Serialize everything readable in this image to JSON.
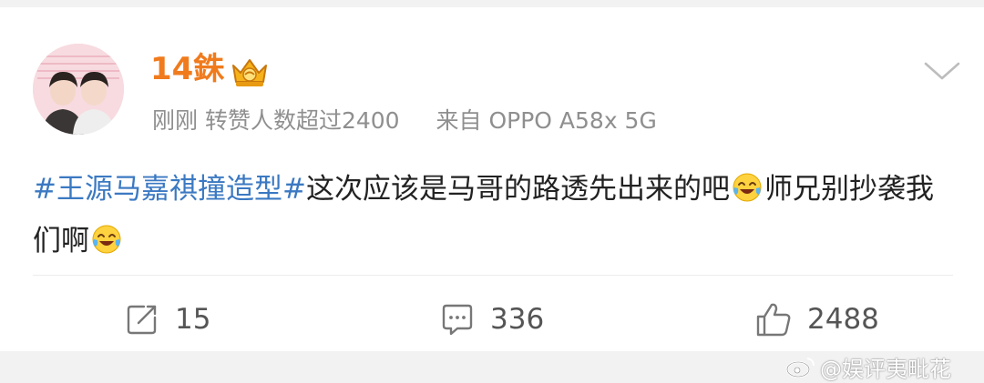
{
  "user": {
    "name": "14銖",
    "badge_icon": "crown-badge-icon"
  },
  "meta": {
    "time": "刚刚",
    "repost_note": "转赞人数超过2400",
    "source": "来自 OPPO A58x 5G"
  },
  "post": {
    "hashtag": "#王源马嘉祺撞造型#",
    "text_part1": "这次应该是马哥的路透先出来的吧",
    "emoji1": "laughing-tears-emoji",
    "text_part2": "师兄别抄袭我们啊",
    "emoji2": "laughing-tears-emoji"
  },
  "actions": {
    "repost_count": "15",
    "comment_count": "336",
    "like_count": "2488"
  },
  "watermark": {
    "text": "@娱评夷毗花",
    "icon": "weibo-logo-icon"
  },
  "colors": {
    "username": "#f07b1d",
    "hashtag": "#3b79c2",
    "meta": "#8f8f8f"
  }
}
